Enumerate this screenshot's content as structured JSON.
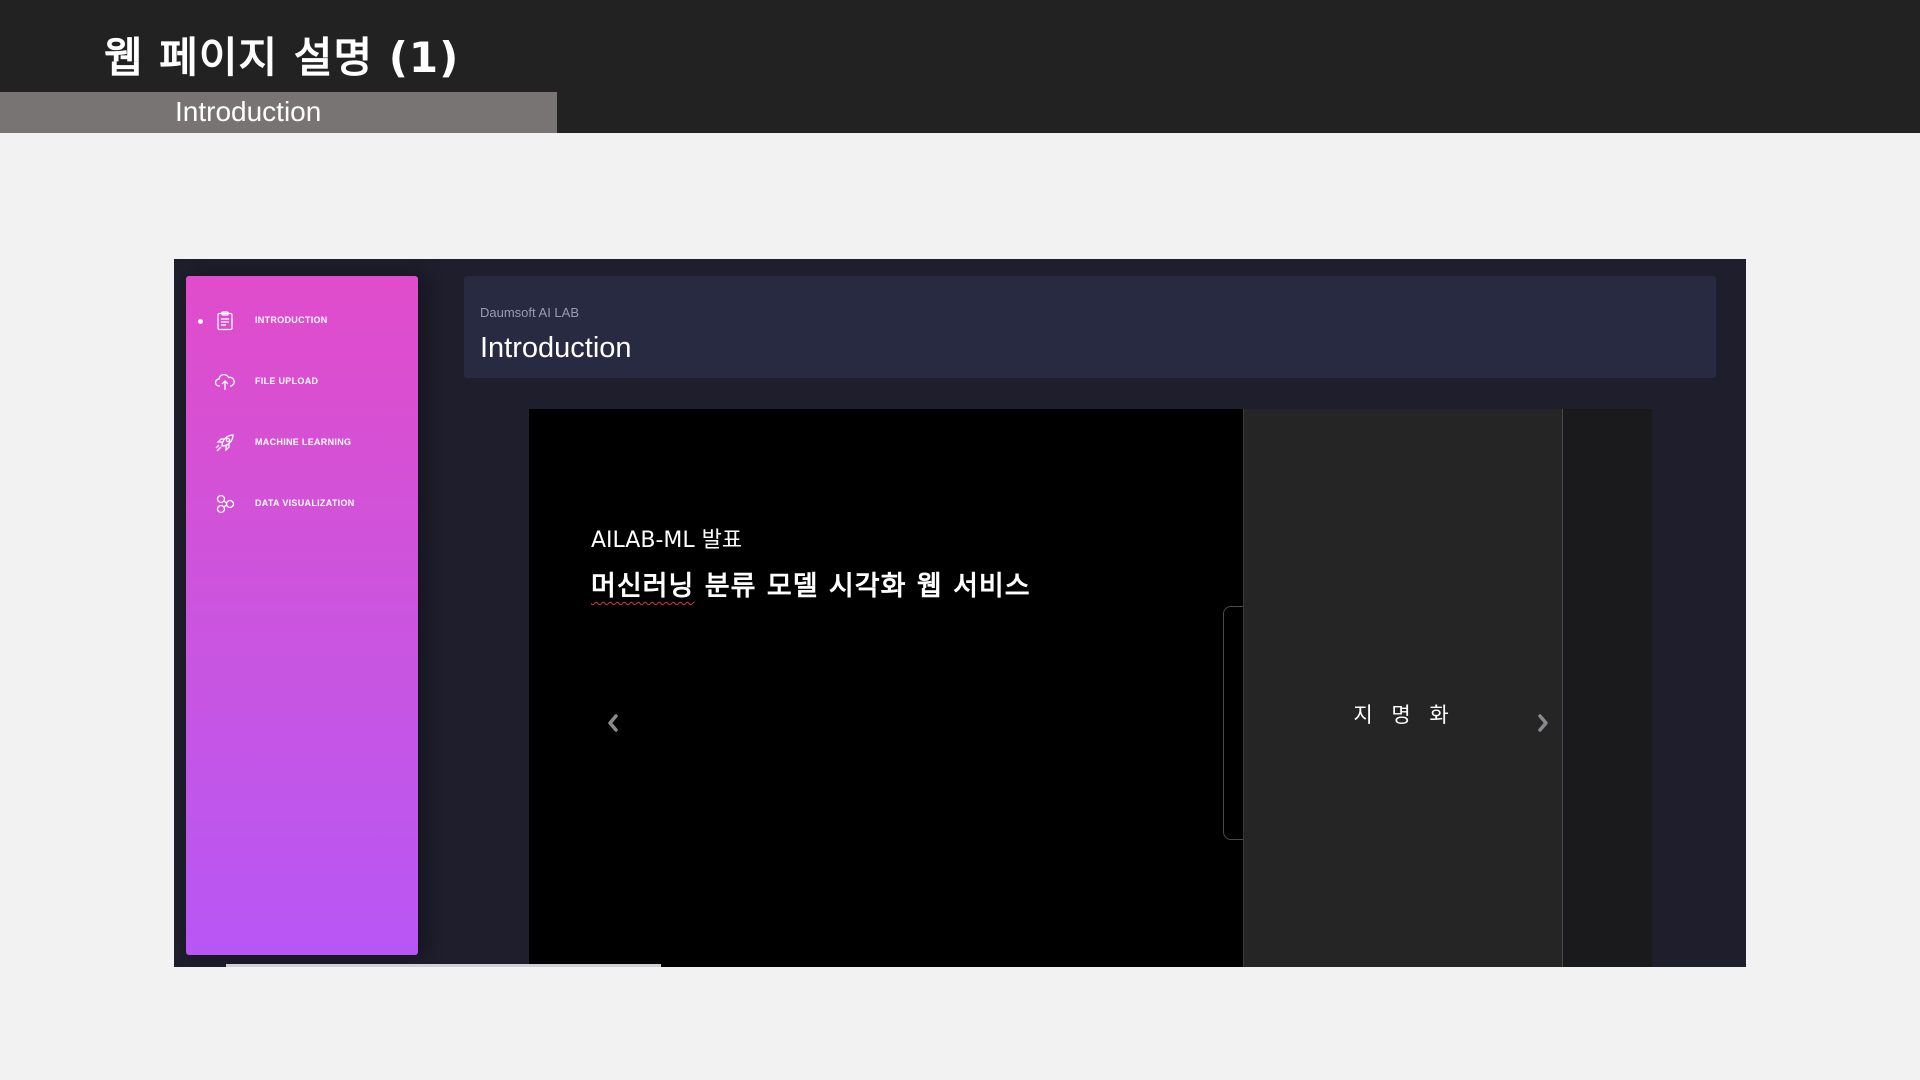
{
  "slide": {
    "title": "웹 페이지 설명 (1)",
    "subtitle": "Introduction"
  },
  "app": {
    "sidebar": {
      "items": [
        {
          "label": "INTRODUCTION",
          "icon": "clipboard-icon",
          "active": true
        },
        {
          "label": "FILE UPLOAD",
          "icon": "cloud-upload-icon",
          "active": false
        },
        {
          "label": "MACHINE LEARNING",
          "icon": "rocket-icon",
          "active": false
        },
        {
          "label": "DATA VISUALIZATION",
          "icon": "molecule-icon",
          "active": false
        }
      ]
    },
    "header": {
      "breadcrumb": "Daumsoft AI LAB",
      "title": "Introduction"
    },
    "carousel": {
      "kicker": "AILAB-ML 발표",
      "headline_underlined": "머신러닝",
      "headline_rest": " 분류 모델 시각화 웹 서비스",
      "side_text": "지 명 화",
      "prev_icon": "chevron-left-icon",
      "next_icon": "chevron-right-icon"
    }
  },
  "colors": {
    "slide_header_bg": "#222222",
    "subtitle_bar_bg": "#787474",
    "sidebar_gradient_top": "#e04ccb",
    "sidebar_gradient_bottom": "#b856f5",
    "app_bg": "#1e1e2c",
    "header_card_bg": "#272a40"
  }
}
